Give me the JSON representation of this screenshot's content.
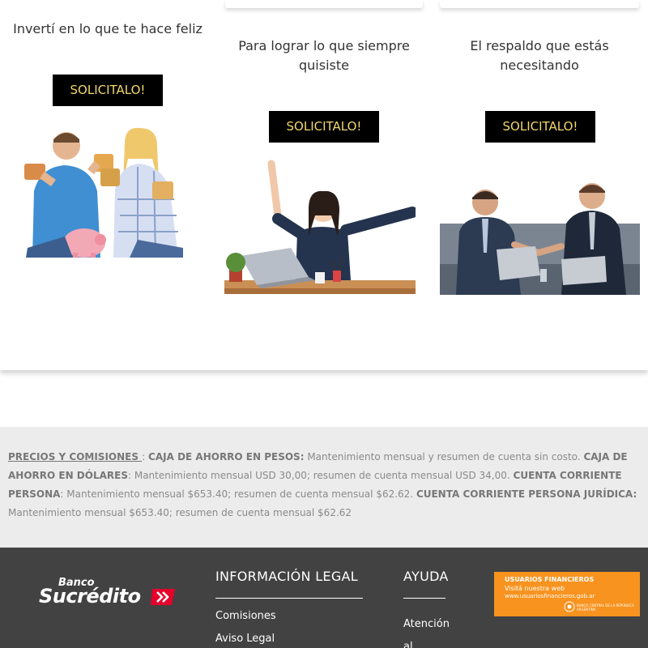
{
  "cards": [
    {
      "title": "Invertí en lo que te hace feliz",
      "button": "SOLICITALO!",
      "image": "couple-with-piggy-bank-photo"
    },
    {
      "title": "Para lograr lo que siempre quisiste",
      "button": "SOLICITALO!",
      "image": "woman-celebrating-at-desk-photo"
    },
    {
      "title": "El respaldo que estás necesitando",
      "button": "SOLICITALO!",
      "image": "business-handshake-photo"
    }
  ],
  "pricing": {
    "link": "PRECIOS Y COMISIONES ",
    "sep1": ": ",
    "k1": "CAJA DE AHORRO EN PESOS:",
    "v1": " Mantenimiento mensual y resumen de cuenta sin costo. ",
    "k2": "CAJA DE AHORRO EN DÓLARES",
    "v2": ": Mantenimiento mensual USD 30,00; resumen de cuenta mensual USD 34,00. ",
    "k3": "CUENTA CORRIENTE PERSONA",
    "v3": ": Mantenimiento mensual $653.40; resumen de cuenta mensual $62.62. ",
    "k4": "CUENTA CORRIENTE PERSONA JURÍDICA:",
    "v4": " Mantenimiento mensual $653.40; resumen de cuenta mensual $62.62"
  },
  "footer": {
    "logo_small": "Banco",
    "logo_big": "Sucrédito",
    "legal_heading": "INFORMACIÓN LEGAL",
    "legal_links": [
      "Comisiones",
      "Aviso Legal"
    ],
    "help_heading": "AYUDA",
    "help_links": [
      "Atención",
      "al"
    ],
    "banner": {
      "line1": "USUARIOS FINANCIEROS",
      "line2": "Visitá nuestra web",
      "line3": "www.usuariosfinancieros.gob.ar",
      "line4": "BANCO CENTRAL DE LA REPÚBLICA ARGENTINA"
    }
  },
  "colors": {
    "button_bg": "#000000",
    "button_text": "#f2d86a",
    "footer_bg": "#424242",
    "pricing_bg": "#ececec",
    "banner_bg": "#f7931e",
    "logo_accent": "#e4002b"
  }
}
